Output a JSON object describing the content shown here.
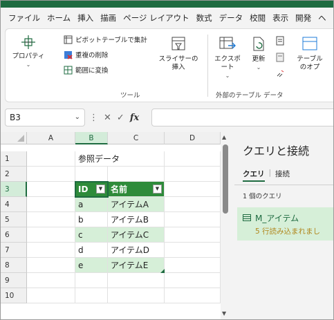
{
  "ribbon_tabs": [
    "ファイル",
    "ホーム",
    "挿入",
    "描画",
    "ページ レイアウト",
    "数式",
    "データ",
    "校閲",
    "表示",
    "開発",
    "ヘ"
  ],
  "ribbon": {
    "properties_label": "プロパティ",
    "pivot_label": "ピボットテーブルで集計",
    "remove_dup_label": "重複の削除",
    "convert_range_label": "範囲に変換",
    "tools_group_label": "ツール",
    "slicer_label_line1": "スライサーの",
    "slicer_label_line2": "挿入",
    "export_label": "エクスポート",
    "refresh_label": "更新",
    "external_group_label": "外部のテーブル データ",
    "table_options_line1": "テーブル",
    "table_options_line2": "のオプ"
  },
  "formula_bar": {
    "name_box": "B3",
    "fx_label": "fx",
    "formula_value": ""
  },
  "sheet": {
    "columns": [
      "A",
      "B",
      "C",
      "D"
    ],
    "rows": [
      "1",
      "2",
      "3",
      "4",
      "5",
      "6",
      "7",
      "8",
      "9",
      "10"
    ],
    "title_cell": "参照データ",
    "table_headers": [
      "ID",
      "名前"
    ],
    "table_rows": [
      [
        "a",
        "アイテムA"
      ],
      [
        "b",
        "アイテムB"
      ],
      [
        "c",
        "アイテムC"
      ],
      [
        "d",
        "アイテムD"
      ],
      [
        "e",
        "アイテムE"
      ]
    ]
  },
  "queries_pane": {
    "title": "クエリと接続",
    "tab_queries": "クエリ",
    "tab_connections": "接続",
    "count_text": "1 個のクエリ",
    "query_name": "M_アイテム",
    "query_status": "5 行読み込まれまし"
  },
  "colors": {
    "accent": "#1e6b40",
    "table_header": "#2e8b3a",
    "band": "#d6efd8",
    "status": "#b0861b"
  }
}
